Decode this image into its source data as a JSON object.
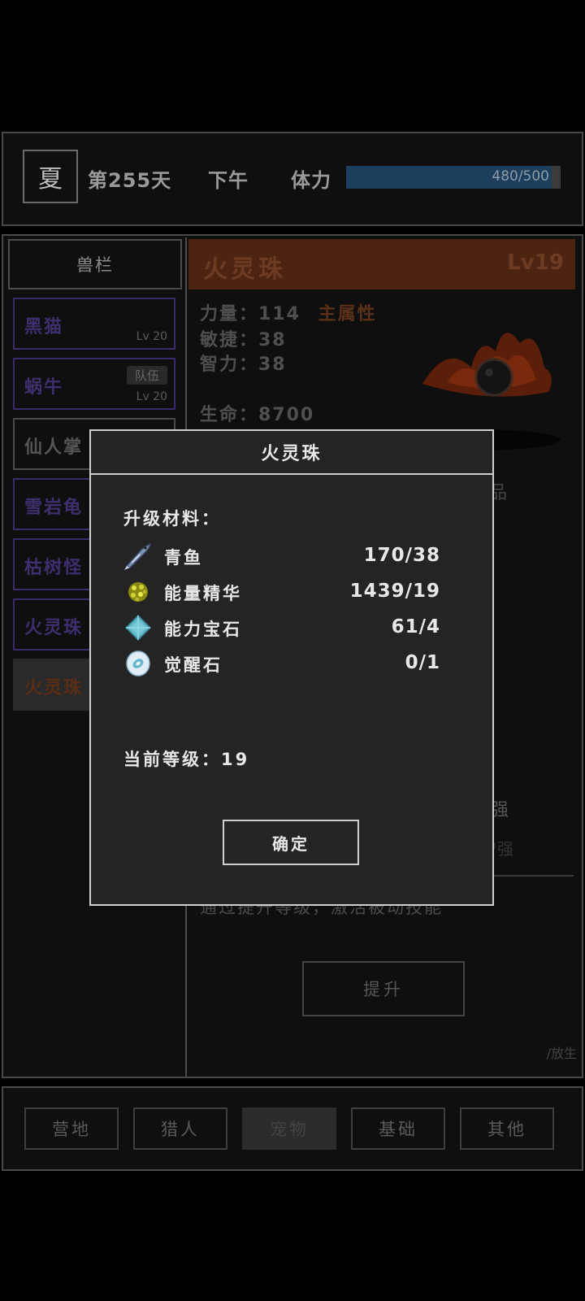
{
  "topbar": {
    "season": "夏",
    "day": "第255天",
    "time_of_day": "下午",
    "stamina_label": "体力",
    "stamina_text": "480/500",
    "stamina_fraction": 0.96,
    "stamina_color": "#1b3f5c"
  },
  "roster": {
    "title": "兽栏",
    "pets": [
      {
        "name": "黑猫",
        "level": "Lv 20",
        "tag": ""
      },
      {
        "name": "蜗牛",
        "level": "Lv 20",
        "tag": "队伍"
      },
      {
        "name": "仙人掌",
        "level": "",
        "tag": ""
      },
      {
        "name": "雪岩龟",
        "level": "",
        "tag": ""
      },
      {
        "name": "枯树怪",
        "level": "",
        "tag": ""
      },
      {
        "name": "火灵珠",
        "level": "",
        "tag": ""
      },
      {
        "name": "火灵珠",
        "level": "",
        "tag": ""
      }
    ]
  },
  "detail": {
    "name": "火灵珠",
    "level": "Lv19",
    "strength": "力量：114",
    "main_attr": "主属性",
    "agility": "敏捷：38",
    "intelligence": "智力：38",
    "hp": "生命：8700",
    "grade_partial": "品",
    "boost_partial_1": "0强",
    "boost_partial_2": "曽强",
    "skill_desc": "通过提升等级，激活被动技能",
    "upgrade_button": "提升",
    "release": "/放生",
    "accent_color": "#4c2411"
  },
  "dialog": {
    "title": "火灵珠",
    "materials_heading": "升级材料：",
    "materials": [
      {
        "name": "青鱼",
        "count": "170/38",
        "icon": "fish-icon"
      },
      {
        "name": "能量精华",
        "count": "1439/19",
        "icon": "energy-essence-icon"
      },
      {
        "name": "能力宝石",
        "count": "61/4",
        "icon": "gem-icon"
      },
      {
        "name": "觉醒石",
        "count": "0/1",
        "icon": "awakening-stone-icon"
      }
    ],
    "current_level": "当前等级：19",
    "confirm_button": "确定"
  },
  "nav": {
    "tabs": [
      "营地",
      "猎人",
      "宠物",
      "基础",
      "其他"
    ],
    "active": "宠物"
  }
}
